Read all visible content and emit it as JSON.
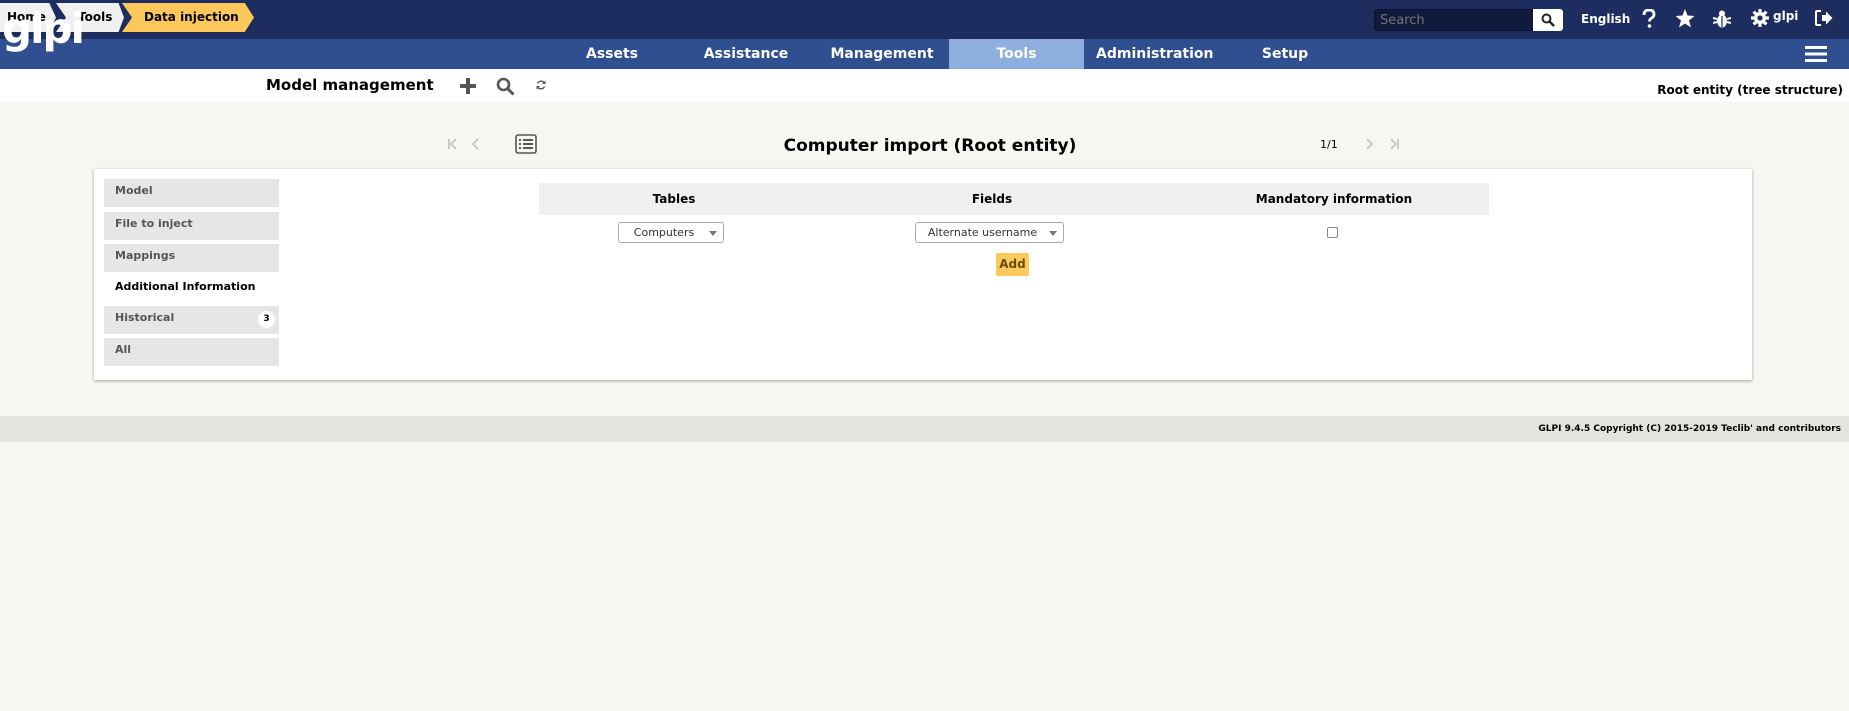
{
  "header": {
    "logo_text": "glpi",
    "search_placeholder": "Search",
    "language": "English",
    "user": "glpi"
  },
  "menu": {
    "items": [
      {
        "label": "Assets"
      },
      {
        "label": "Assistance"
      },
      {
        "label": "Management"
      },
      {
        "label": "Tools"
      },
      {
        "label": "Administration"
      },
      {
        "label": "Setup"
      }
    ],
    "active_index": 3,
    "active_color": "#8eaedf"
  },
  "breadcrumb": {
    "home": "Home",
    "tools": "Tools",
    "data_injection": "Data injection",
    "page_title": "Model management"
  },
  "entity": "Root entity (tree structure)",
  "navigation": {
    "item_title": "Computer import (Root entity)",
    "counter": "1/1"
  },
  "tabs": [
    {
      "label": "Model"
    },
    {
      "label": "File to inject"
    },
    {
      "label": "Mappings"
    },
    {
      "label": "Additional Information"
    },
    {
      "label": "Historical",
      "badge": "3"
    },
    {
      "label": "All"
    }
  ],
  "active_tab_index": 3,
  "form": {
    "headers": {
      "tables": "Tables",
      "fields": "Fields",
      "mandatory": "Mandatory information"
    },
    "table_select": "Computers",
    "field_select": "Alternate username",
    "mandatory_checked": false,
    "add_label": "Add"
  },
  "footer": {
    "text": "GLPI 9.4.5 Copyright (C) 2015-2019 Teclib' and contributors"
  },
  "colors": {
    "header_bg": "#1d2d5f",
    "menu_bg": "#2f4f91",
    "accent": "#fdc759"
  }
}
